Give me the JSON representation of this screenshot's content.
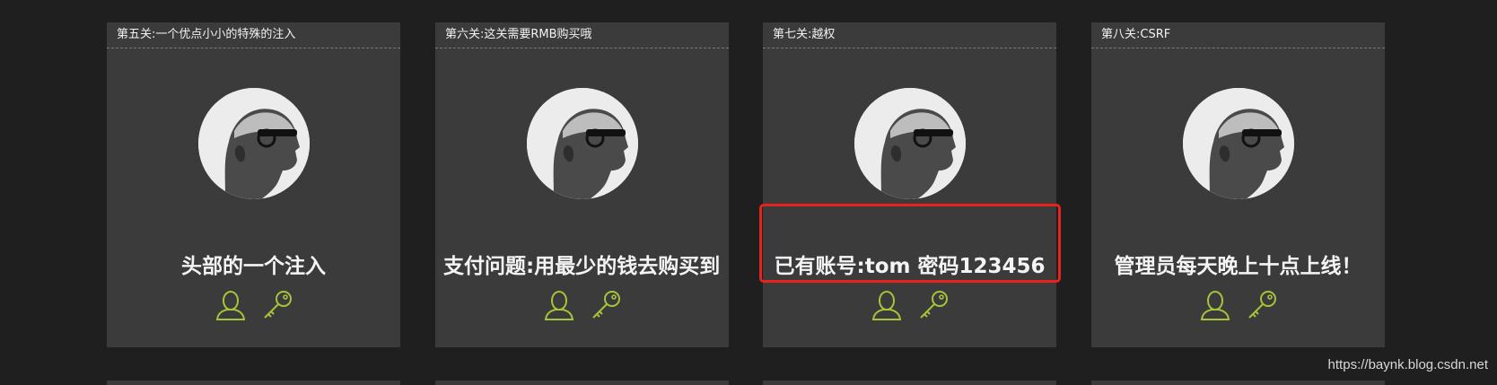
{
  "cards": [
    {
      "header": "第五关:一个优点小小的特殊的注入",
      "description": "头部的一个注入",
      "user_icon": "user-outline-icon",
      "key_icon": "key-icon"
    },
    {
      "header": "第六关:这关需要RMB购买哦",
      "description": "支付问题:用最少的钱去购买到",
      "user_icon": "user-outline-icon",
      "key_icon": "key-icon"
    },
    {
      "header": "第七关:越权",
      "description": "已有账号:tom 密码123456",
      "user_icon": "user-outline-icon",
      "key_icon": "key-icon"
    },
    {
      "header": "第八关:CSRF",
      "description": "管理员每天晚上十点上线！",
      "user_icon": "user-outline-icon",
      "key_icon": "key-icon"
    }
  ],
  "annotation": {
    "color": "#e8231d"
  },
  "colors": {
    "page_bg": "#1f1f1f",
    "card_bg": "#3b3b3b",
    "icon_accent": "#a6c43a"
  },
  "watermark": "https://baynk.blog.csdn.net"
}
